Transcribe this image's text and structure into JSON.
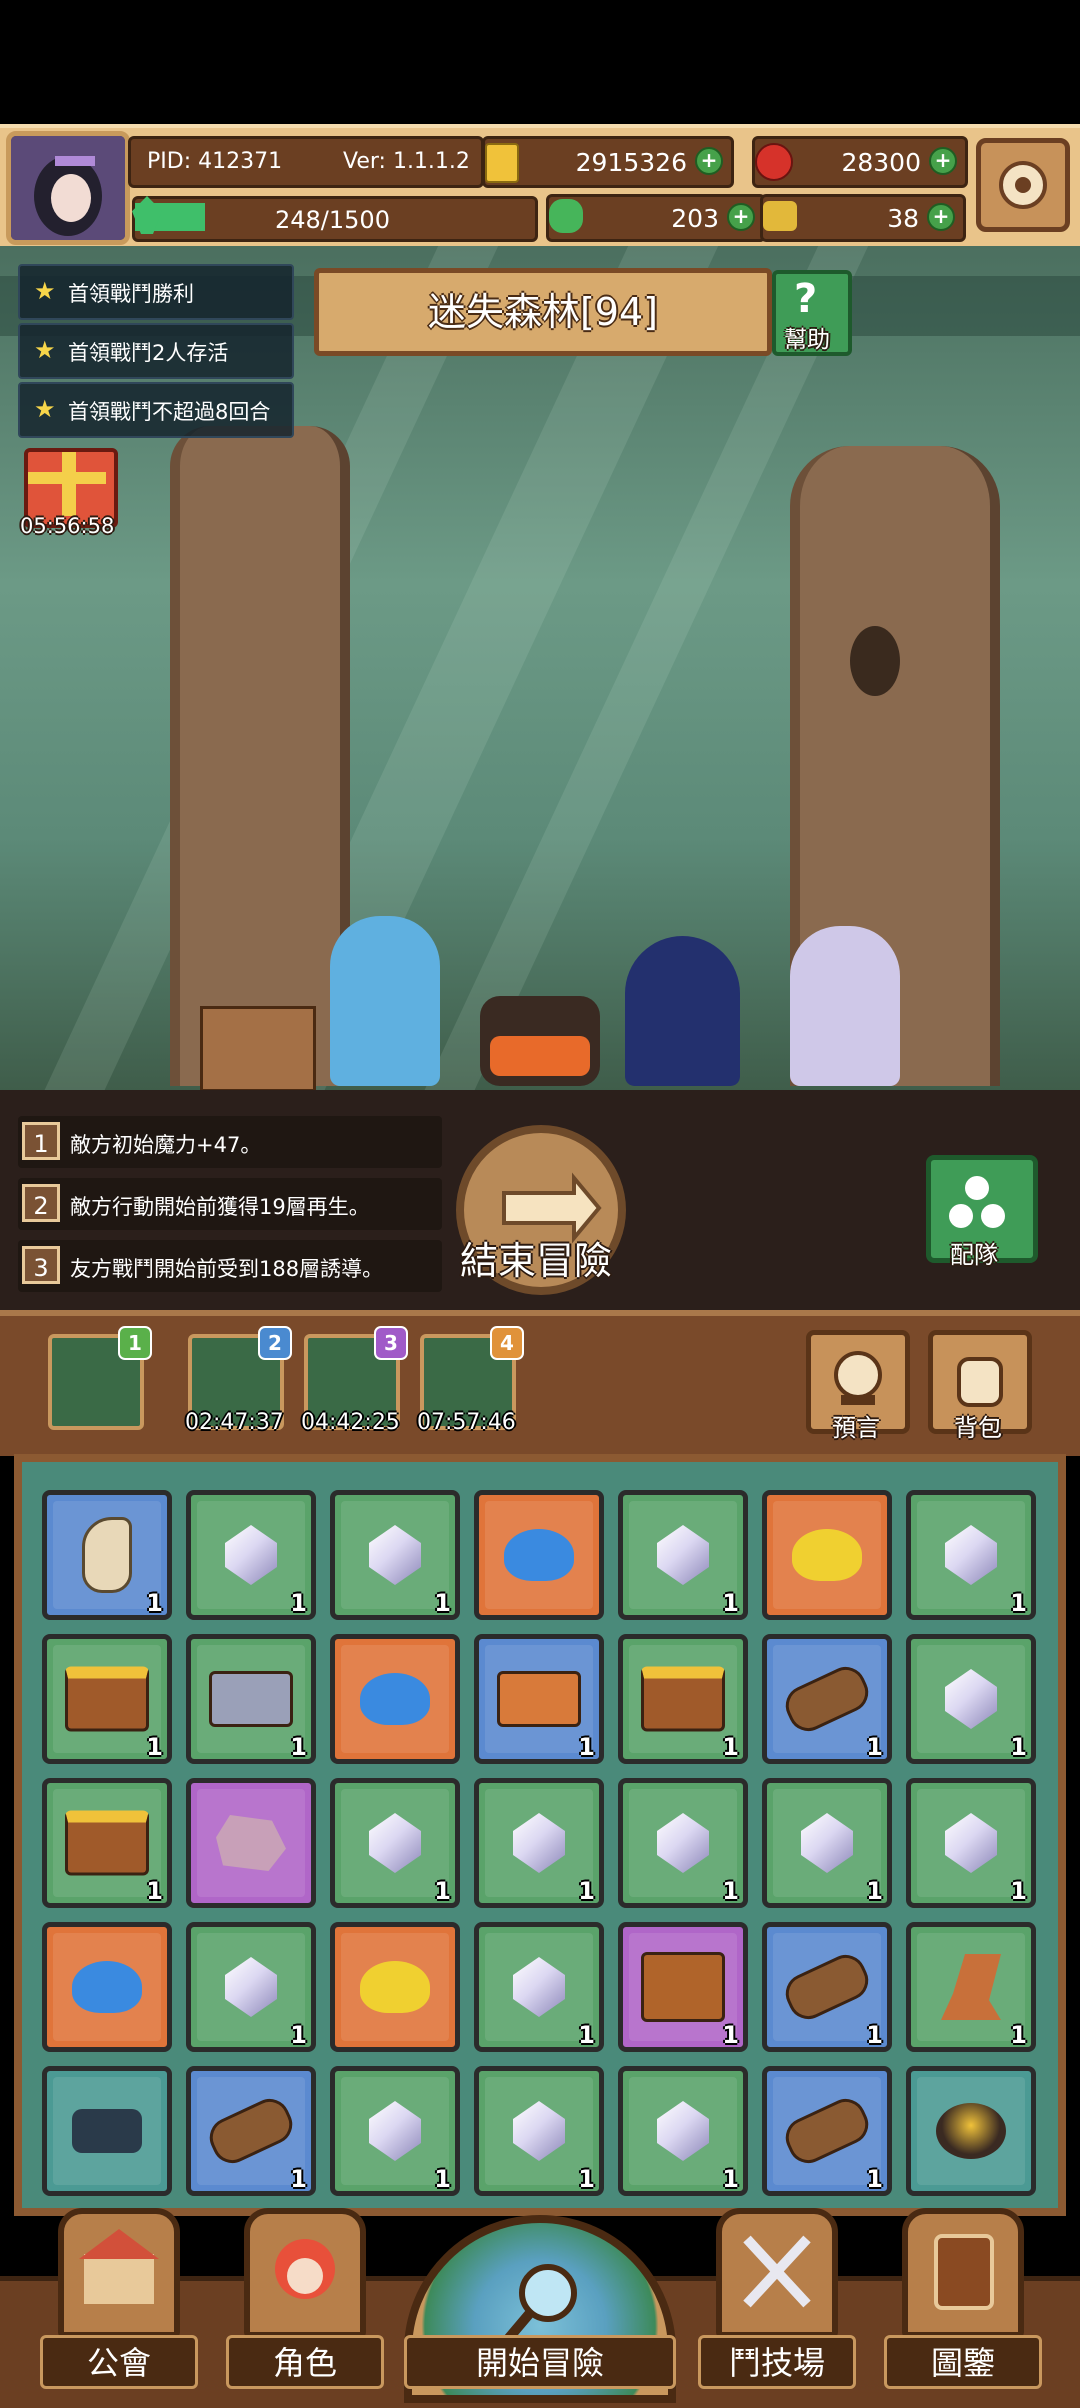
{
  "player": {
    "pid": "PID: 412371",
    "version": "Ver: 1.1.1.2",
    "gold": "2915326",
    "gems": "28300",
    "energy": "248/1500",
    "clovers": "203",
    "keys": "38"
  },
  "quests": [
    {
      "label": "首領戰鬥勝利"
    },
    {
      "label": "首領戰鬥2人存活"
    },
    {
      "label": "首領戰鬥不超過8回合"
    }
  ],
  "gift_timer": "05:56:58",
  "stage_title": "迷失森林[94]",
  "help_label": "幫助",
  "effects": [
    {
      "num": "1",
      "text": "敵方初始魔力+47。"
    },
    {
      "num": "2",
      "text": "敵方行動開始前獲得19層再生。"
    },
    {
      "num": "3",
      "text": "友方戰鬥開始前受到188層誘導。"
    }
  ],
  "end_adventure_label": "結束冒險",
  "team_label": "配隊",
  "slots": [
    {
      "badge": "1",
      "timer": ""
    },
    {
      "badge": "2",
      "timer": "02:47:37"
    },
    {
      "badge": "3",
      "timer": "04:42:25"
    },
    {
      "badge": "4",
      "timer": "07:57:46"
    }
  ],
  "prophecy_label": "預言",
  "backpack_label": "背包",
  "inventory": [
    [
      {
        "type": "horn",
        "bg": "blue",
        "count": "1"
      },
      {
        "type": "gem",
        "bg": "green",
        "count": "1"
      },
      {
        "type": "gem",
        "bg": "green",
        "count": "1"
      },
      {
        "type": "slime-blue",
        "bg": "orange",
        "count": ""
      },
      {
        "type": "gem",
        "bg": "green",
        "count": "1"
      },
      {
        "type": "slime-yellow",
        "bg": "orange",
        "count": ""
      },
      {
        "type": "gem",
        "bg": "green",
        "count": "1"
      }
    ],
    [
      {
        "type": "gold-chest",
        "bg": "green",
        "count": "1"
      },
      {
        "type": "silver-chest",
        "bg": "green",
        "count": "1"
      },
      {
        "type": "slime-blue",
        "bg": "orange",
        "count": ""
      },
      {
        "type": "treasure-chest",
        "bg": "blue",
        "count": "1"
      },
      {
        "type": "gold-chest",
        "bg": "green",
        "count": "1"
      },
      {
        "type": "log",
        "bg": "blue",
        "count": "1"
      },
      {
        "type": "gem",
        "bg": "green",
        "count": "1"
      }
    ],
    [
      {
        "type": "gold-chest",
        "bg": "green",
        "count": "1"
      },
      {
        "type": "ore",
        "bg": "purple",
        "count": ""
      },
      {
        "type": "gem",
        "bg": "green",
        "count": "1"
      },
      {
        "type": "gem",
        "bg": "green",
        "count": "1"
      },
      {
        "type": "gem",
        "bg": "green",
        "count": "1"
      },
      {
        "type": "gem",
        "bg": "green",
        "count": "1"
      },
      {
        "type": "gem",
        "bg": "green",
        "count": "1"
      }
    ],
    [
      {
        "type": "slime-blue",
        "bg": "orange",
        "count": ""
      },
      {
        "type": "gem",
        "bg": "green",
        "count": "1"
      },
      {
        "type": "slime-yellow",
        "bg": "orange",
        "count": ""
      },
      {
        "type": "gem",
        "bg": "green",
        "count": "1"
      },
      {
        "type": "wood-chest",
        "bg": "purple",
        "count": "1"
      },
      {
        "type": "log",
        "bg": "blue",
        "count": "1"
      },
      {
        "type": "boot",
        "bg": "green",
        "count": "1"
      }
    ],
    [
      {
        "type": "wreck",
        "bg": "teal",
        "count": ""
      },
      {
        "type": "log",
        "bg": "blue",
        "count": "1"
      },
      {
        "type": "gem",
        "bg": "green",
        "count": "1"
      },
      {
        "type": "gem",
        "bg": "green",
        "count": "1"
      },
      {
        "type": "gem",
        "bg": "green",
        "count": "1"
      },
      {
        "type": "log",
        "bg": "blue",
        "count": "1"
      },
      {
        "type": "campfire",
        "bg": "teal",
        "count": ""
      }
    ]
  ],
  "colors": {
    "green": "#5aa36a",
    "blue": "#5b8ad0",
    "orange": "#e0743a",
    "purple": "#b066c8",
    "teal": "#4b9a94"
  },
  "nav": {
    "guild": "公會",
    "character": "角色",
    "start": "開始冒險",
    "arena": "鬥技場",
    "codex": "圖鑒"
  }
}
